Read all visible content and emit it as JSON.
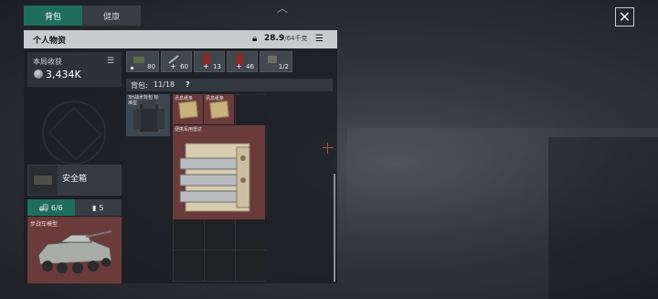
{
  "tabs": [
    {
      "label": "背包",
      "active": true
    },
    {
      "label": "健康",
      "active": false
    }
  ],
  "header": {
    "title": "个人物资",
    "weight_value": "28.9",
    "weight_capacity": "/64千克"
  },
  "income": {
    "label": "本局收获",
    "value": "3,434K"
  },
  "safebox": {
    "label": "安全箱"
  },
  "vehicle_tabs": [
    {
      "label": "6/6",
      "icon": "truck-icon",
      "active": true
    },
    {
      "label": "5",
      "icon": "battery-icon",
      "active": false
    }
  ],
  "vehicle": {
    "label": "步战车模型"
  },
  "quick_slots": [
    {
      "qty": "80",
      "marker": "dot",
      "icon": "ammo-box-icon"
    },
    {
      "qty": "60",
      "marker": "plus",
      "icon": "syringe-icon"
    },
    {
      "qty": "13",
      "marker": "plus",
      "icon": "medkit-icon"
    },
    {
      "qty": "46",
      "marker": "plus",
      "icon": "medkit-icon"
    },
    {
      "qty": "1/2",
      "marker": "none",
      "icon": "grenade-icon"
    }
  ],
  "bag": {
    "label": "背包:",
    "count": "11/18",
    "help": "?"
  },
  "items": {
    "armor_label": "3H战术背包 标准型",
    "doc1_label": "讯息纸条",
    "doc2_label": "讯息纸条",
    "radio_label": "便携军用雷达"
  },
  "colors": {
    "accent_green": "#1f6d5b",
    "item_red": "#6b3a3a",
    "header_bar": "#c9ccce"
  }
}
